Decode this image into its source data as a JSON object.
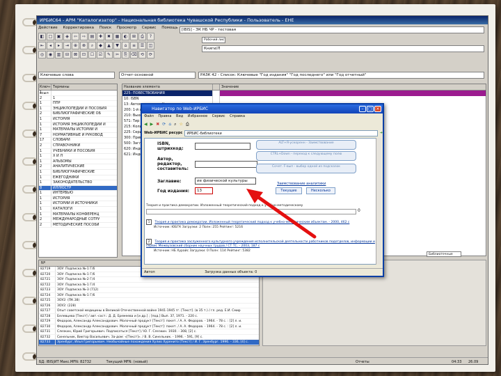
{
  "app": {
    "title": "ИРБИС64 - АРМ \"Каталогизатор\" - Национальная библиотека Чувашской Республики - Пользователь - ЕНЕ",
    "menu": [
      "Действие",
      "Корректировка",
      "Поиск",
      "Просмотр",
      "Сервис",
      "Помощь"
    ],
    "toolbar_row1": [
      "◧",
      "□",
      "▣",
      "◈",
      "⇦",
      "⇨",
      "▤",
      "✚",
      "✖",
      "▦",
      "◐",
      "⊞",
      "⎙",
      "?"
    ],
    "toolbar_row2": [
      "⇤",
      "◂",
      "▸",
      "⇥",
      "⊕",
      "⊗",
      "⌕",
      "◆",
      "▲",
      "▼",
      "⌂",
      "≡",
      "☰",
      "◫"
    ],
    "toolbar_row3": [
      "◎",
      "◉",
      "▥",
      "⊟",
      "⊠",
      "⊡",
      "☐",
      "☑",
      "✎",
      "✂",
      "⎘",
      "⌫",
      "⟲",
      "⟳"
    ],
    "database_field": "[IBIS] - ЭК НБ ЧР - тестовая",
    "worksheet_tab": "Рабочий лист PAZK",
    "worksheet_field": "Книги/Л",
    "search_label": "Ключевые слова",
    "search_mode": "Отчет-основной",
    "query_text": "РАЗК 42 - Список: Ключевые \"Год издания\" \"Год последнего\" или \"Год отчетный\""
  },
  "dict": {
    "headers": [
      "Ключ-ссыл",
      "Термины"
    ],
    "rows": [
      {
        "n": "1",
        "t": ""
      },
      {
        "n": "2",
        "t": "1"
      },
      {
        "n": "1",
        "t": "ППР"
      },
      {
        "n": "1",
        "t": "ЭНЦИКЛОПЕДИИ И ПОСОБИЯ"
      },
      {
        "n": "2",
        "t": "БИБЛИОГРАФИЧЕСКИЕ ОБ"
      },
      {
        "n": "1",
        "t": "ИСТОРИЯ"
      },
      {
        "n": "1",
        "t": "ИСТОРИЯ ЭНЦИКЛОПЕДИИ И"
      },
      {
        "n": "1",
        "t": "МАТЕРИАЛЫ ИСТОРИИ И"
      },
      {
        "n": "7",
        "t": "НОРМАТИВНЫЕ И РУКОВОД"
      },
      {
        "n": "17",
        "t": "СЛОВАРИ"
      },
      {
        "n": "2",
        "t": "СПРАВОЧНИКИ"
      },
      {
        "n": "1",
        "t": "УЧЕБНИКИ И ПОСОБИЯ"
      },
      {
        "n": "1",
        "t": "Х И Л"
      },
      {
        "n": "1",
        "t": "АЛЬБОМЫ"
      },
      {
        "n": "2",
        "t": "АНАЛИТИЧЕСКИЕ"
      },
      {
        "n": "1",
        "t": "БИБЛИОГРАФИЧЕСКИЕ"
      },
      {
        "n": "1",
        "t": "ЕЖЕГОДНИКИ"
      },
      {
        "n": "1",
        "t": "ЗАКОНОДАТЕЛЬСТВО"
      },
      {
        "n": "8",
        "t": "ИЛЛЮСТР"
      },
      {
        "n": "1",
        "t": "ИНТЕРВЬЮ"
      },
      {
        "n": "1",
        "t": "ИСТОРИЯ"
      },
      {
        "n": "1",
        "t": "ИСТОРИИ И ИСТОЧНИКИ"
      },
      {
        "n": "1",
        "t": "КАТАЛОГИ"
      },
      {
        "n": "1",
        "t": "МАТЕРИАЛЫ КОНФЕРЕНЦ"
      },
      {
        "n": "2",
        "t": "МЕЖДУНАРОДНЫЕ СОТРУ"
      },
      {
        "n": "2",
        "t": "МЕТОДИЧЕСКИЕ ПОСОБИ"
      }
    ],
    "selected_index": 18
  },
  "record": {
    "headers": [
      "Название элемента",
      "Значение"
    ],
    "rows": [
      {
        "name": "225: ПОВЕСТВОВАНИЯ",
        "val": "",
        "hl": true
      },
      {
        "name": "10: ISBN",
        "val": ""
      },
      {
        "name": "13: Автоматическое Название книги",
        "val": ""
      },
      {
        "name": "200: 1-й автор - Заголовок описания",
        "val": ""
      },
      {
        "name": "210: Выходные данные",
        "val": ""
      },
      {
        "name": "571: Тир",
        "val": ""
      },
      {
        "name": "215: Количественные",
        "val": ""
      },
      {
        "name": "225: Серия",
        "val": ""
      },
      {
        "name": "300: Примечание",
        "val": ""
      },
      {
        "name": "500: Заглавие",
        "val": ""
      },
      {
        "name": "620: Индекс",
        "val": ""
      },
      {
        "name": "621: Индекс",
        "val": ""
      }
    ],
    "tabs": [
      "Дубликаты",
      "Библиотечные"
    ]
  },
  "blist": {
    "header": "Nº",
    "rows": [
      {
        "n": "82719",
        "t": "ЗОУ: Подписка №-1 Г/6"
      },
      {
        "n": "82720",
        "t": "ЗОУ: Подписка №-1 Г/6"
      },
      {
        "n": "82721",
        "t": "ЗОУ: Подписка №-2 Г/4"
      },
      {
        "n": "82722",
        "t": "ЗОУ: Подписка №-1 Г/4"
      },
      {
        "n": "82723",
        "t": "ЗОУ: Подписка №-3 (712)"
      },
      {
        "n": "82724",
        "t": "ЗОУ: Подписка №-1 Г/6"
      },
      {
        "n": "82725",
        "t": "ЗОУ2: (ПК.38)"
      },
      {
        "n": "82726",
        "t": "ЗОУ2: (228)"
      },
      {
        "n": "82727",
        "t": "Опыт советской медицины в Великой Отечественной войне 1941-1945 гг. [Текст]. (в 35 т.) / гл. ред. Е.И. Смир"
      },
      {
        "n": "82728",
        "t": "Белевцева [Текст] / авт.-сост.: Д. Д. Еремеева и [и др.] ; [под.] Вып. 37, 1971. - 220 с."
      },
      {
        "n": "82729",
        "t": "Федоров, Александр Александрович. Молочный продукт [Текст]: покет. / А. А. Федоров. - 1964. - 78 с. : [2] л. и."
      },
      {
        "n": "82730",
        "t": "Федоров, Александр Александрович. Молочный продукт [Текст]: покет. / А. А. Федоров. - 1964. - 78 с. : [2] л. и."
      },
      {
        "n": "82731",
        "t": "Слезкин, Юрий Григорьевич. Подписаться [Текст] / Ю. Г. Слезкин. 1930. - 308, [2] с."
      },
      {
        "n": "82732",
        "t": "Синельник, Виктор Васильевич. За-дом: «[Текст]». / В. В. Синельник. - 1996. - 591, [9] с."
      },
      {
        "n": "82733",
        "t": "Эренбург, Илья Григорьевич. Необычайные похождения Хулио Хуренито [Текст] / И. Г. Эренбург. 1996. - 336, [4] с."
      },
      {
        "n": "",
        "t": "новый"
      }
    ],
    "selected_index": 14
  },
  "status": {
    "left": "БД: IBIS|ИТ Макс.MFN: 82732",
    "middle": "Текущий MFN: (новый)",
    "right_mode": "Отчеты",
    "time": "04:33",
    "count": "26.09"
  },
  "modal": {
    "title": "Навигатор по Web-ИРБИС",
    "menu": [
      "Файл",
      "Правка",
      "Вид",
      "Избранное",
      "Сервис",
      "Справка"
    ],
    "nav": [
      "◀",
      "▶",
      "✖",
      "⟳",
      "⌂",
      "⌕",
      "☆",
      "⎙"
    ],
    "address_label": "Web-ИРБИС ресурс",
    "address_value": "ИРБИС-библиотеки",
    "isbn_label": "ISBN,",
    "isbn_label2": "штрихкод:",
    "author_label": "Автор,",
    "author_label2": "редактор,",
    "author_label3": "составитель:",
    "title_label": "Заглавие:",
    "title_value": "ие физической культуры",
    "year_label": "Год издания:",
    "year_value": "13",
    "pill1": "ALT+Я-ускоренн - Заимствование",
    "pill2": "CTRL+Down - переход к следующему полю",
    "pill3": "Сочет. F-вып - выбор одной из подсказок",
    "anal_title": "Заимствование аналитики",
    "btn_left": "Текущие",
    "btn_right": "Несколько",
    "summary_text": "Теория и практика демократии. Изложенный теоретический подход к учебно-методическому",
    "summary_count": "0",
    "result1_num": "1",
    "result1_title": "Теория и практика демократии. Изложенный теоретический подход к учебно-методическим объектам. - 2000, 462 с",
    "result1_meta": "Источник: ЮБГК   Загрузки: 2   Полн: 255   Рейтинг: 5216",
    "result2_num": "2",
    "result2_title": "Теория и практика заслуженного культурного учреждения исполнительской деятельности работников подотделов, информации и сервис Межвузовский сборник научных трудов / СТ ТС. - 2003, 187 с",
    "result2_meta": "Источник: НБ Хурайс   Загрузки: 0   Полн: 114   Рейтинг: 5382",
    "status_left": "Автоп",
    "status_mid": "Загрузка данных объекта: 0"
  }
}
